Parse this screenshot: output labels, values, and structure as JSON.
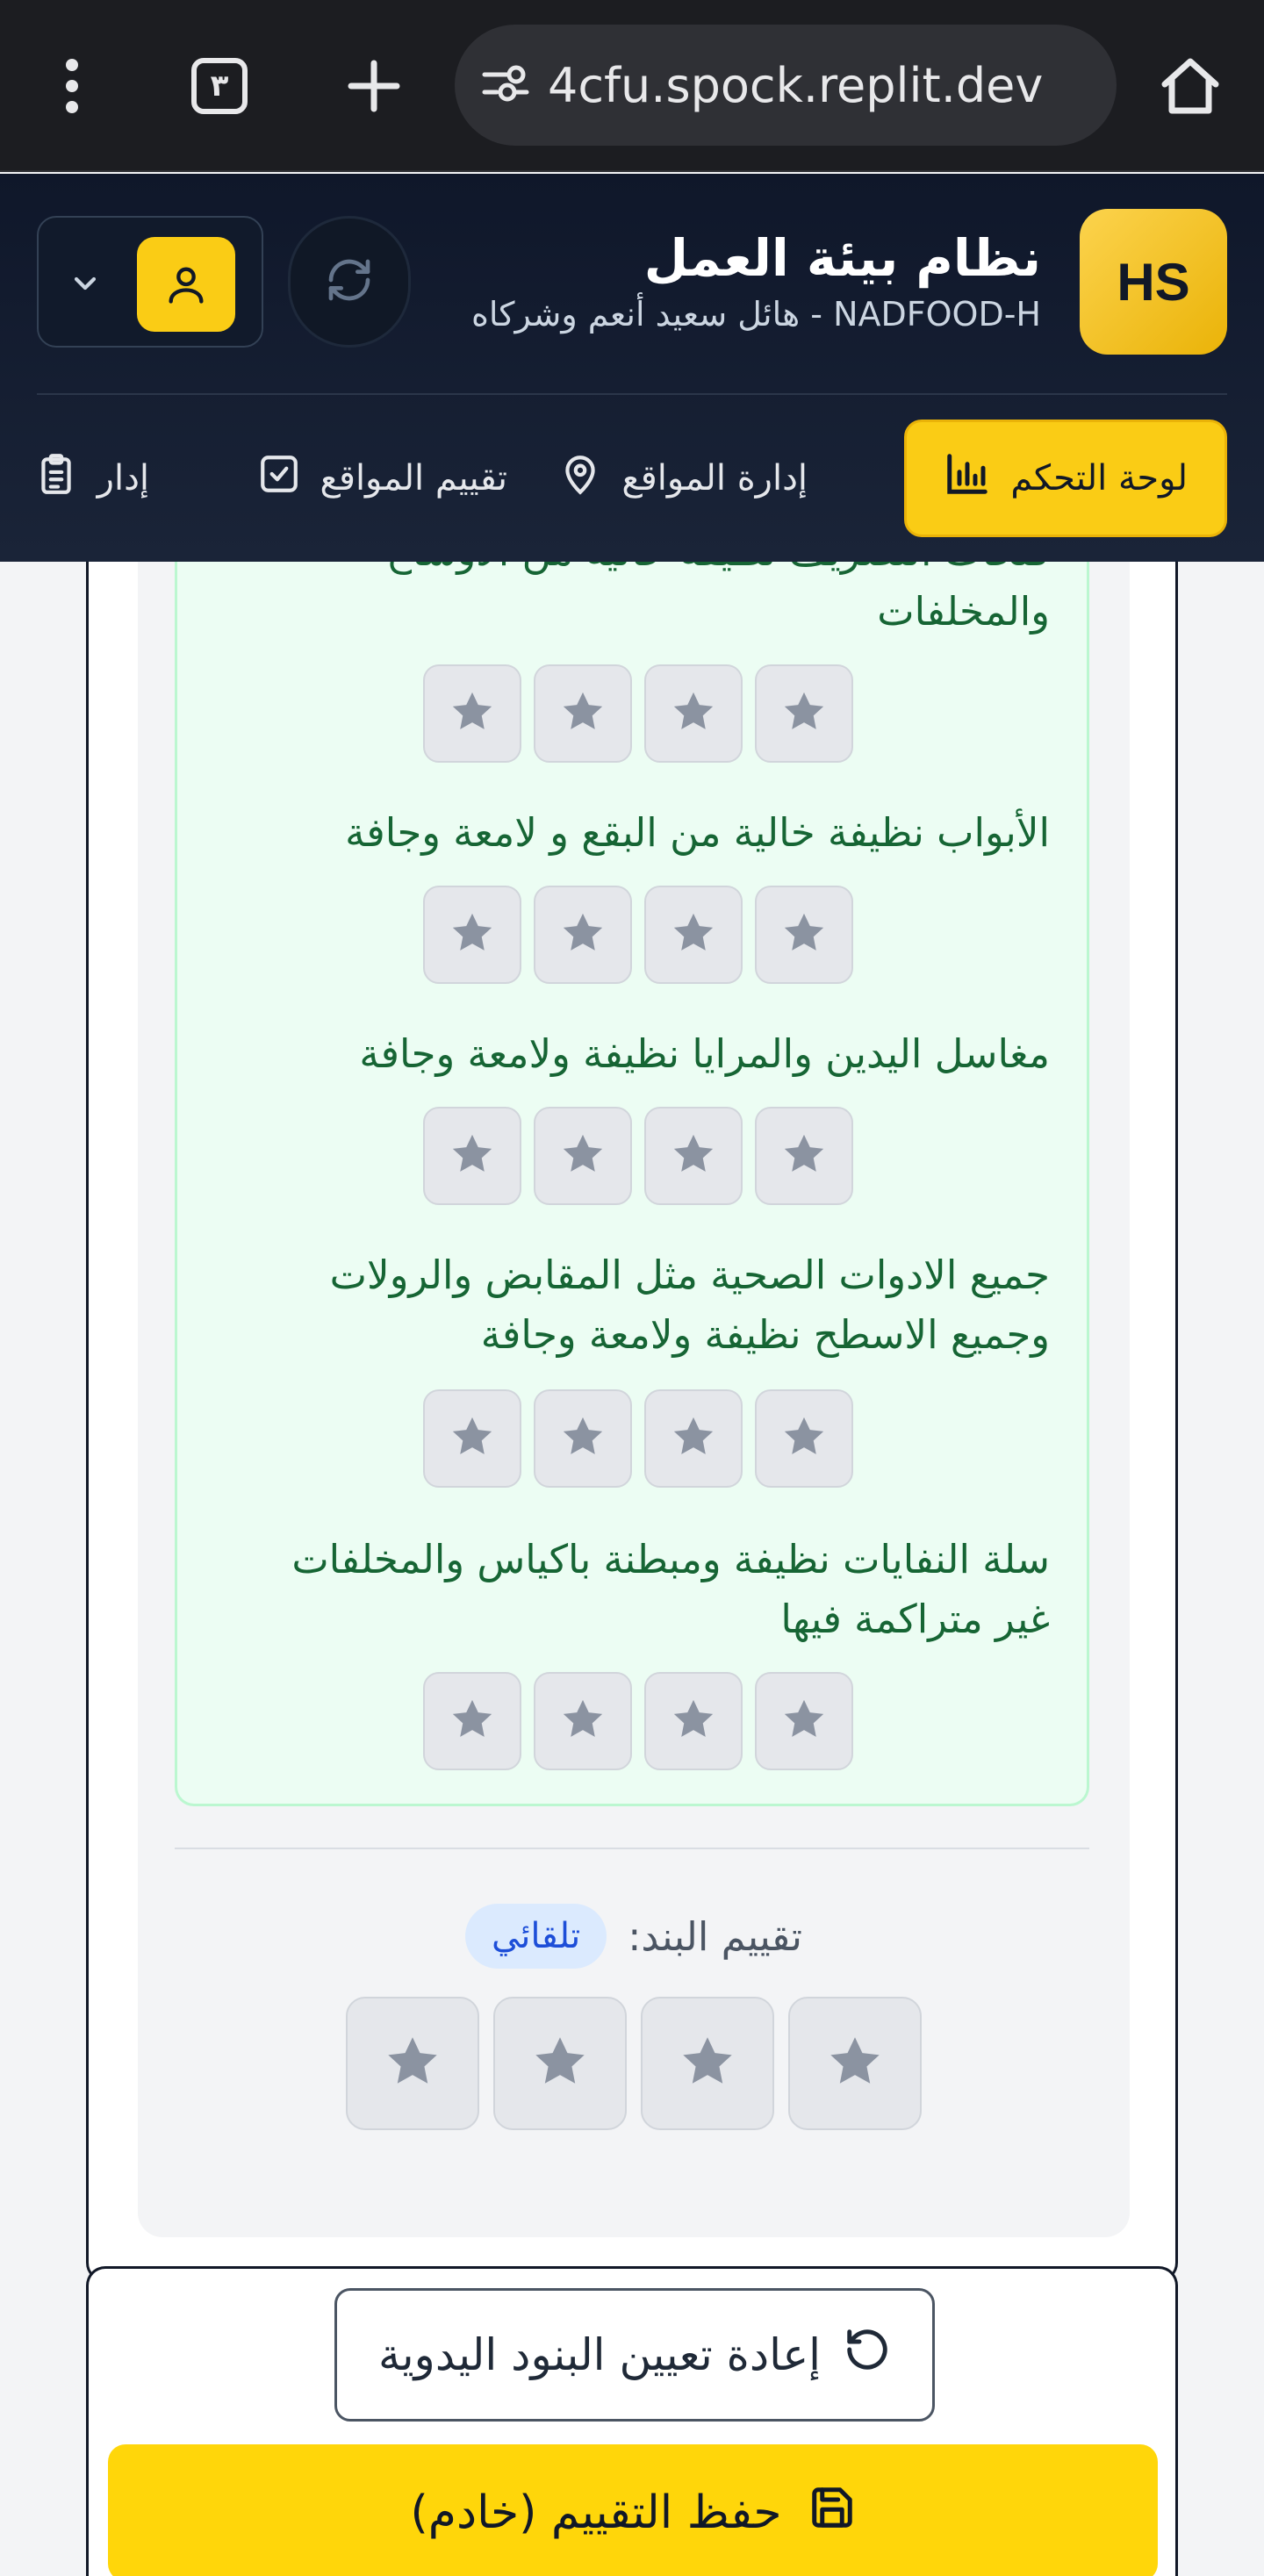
{
  "browser": {
    "url": "4cfu.spock.replit.dev",
    "tab_count": "٣",
    "icons": [
      "home-icon",
      "site-settings-icon",
      "new-tab-icon",
      "tabs-icon",
      "more-menu-icon"
    ]
  },
  "header": {
    "logo_text": "HS",
    "title": "نظام بيئة العمل",
    "subtitle": "NADFOOD-H - هائل سعيد أنعم وشركاه"
  },
  "nav": {
    "items": [
      {
        "label": "لوحة التحكم",
        "icon": "bar-chart-icon",
        "active": true
      },
      {
        "label": "إدارة المواقع",
        "icon": "map-pin-icon",
        "active": false
      },
      {
        "label": "تقييم المواقع",
        "icon": "check-square-icon",
        "active": false
      },
      {
        "label": "إدار",
        "icon": "clipboard-list-icon",
        "active": false
      }
    ]
  },
  "criteria": [
    {
      "label": "فتحات التصريف نظيفة خالية من الاوساخ والمخلفات"
    },
    {
      "label": "الأبواب نظيفة خالية من البقع و لامعة وجافة"
    },
    {
      "label": "مغاسل اليدين والمرايا نظيفة ولامعة وجافة"
    },
    {
      "label": "جميع الادوات الصحية مثل المقابض والرولات وجميع الاسطح نظيفة ولامعة وجافة"
    },
    {
      "label": "سلة النفايات نظيفة ومبطنة باكياس والمخلفات غير متراكمة فيها"
    }
  ],
  "item_rating": {
    "label": "تقييم البند:",
    "badge": "تلقائي"
  },
  "actions": {
    "reset_label": "إعادة تعيين البنود اليدوية",
    "save_label": "حفظ التقييم (خادم)"
  },
  "colors": {
    "accent": "#facc15",
    "header_bg": "#0f172a",
    "criteria_text": "#166534",
    "criteria_bg": "#ecfdf3"
  }
}
